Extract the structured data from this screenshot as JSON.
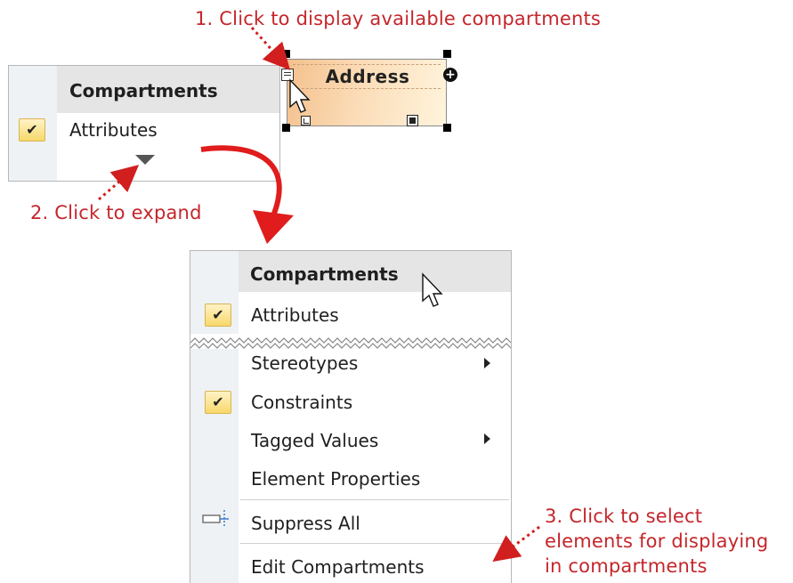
{
  "annotations": {
    "step1": "1. Click to display available compartments",
    "step2": "2. Click to expand",
    "step3_line1": "3. Click to select",
    "step3_line2": "elements for displaying",
    "step3_line3": "in compartments"
  },
  "element": {
    "title": "Address"
  },
  "collapsed_menu": {
    "header": "Compartments",
    "items": [
      {
        "label": "Attributes",
        "checked": true
      }
    ]
  },
  "expanded_menu": {
    "header": "Compartments",
    "items": [
      {
        "label": "Attributes",
        "checked": true
      },
      {
        "label": "Stereotypes",
        "checked": false,
        "submenu": true
      },
      {
        "label": "Constraints",
        "checked": true
      },
      {
        "label": "Tagged Values",
        "checked": false,
        "submenu": true
      },
      {
        "label": "Element Properties",
        "checked": false
      },
      {
        "label": "Suppress All",
        "icon": "suppress-icon"
      },
      {
        "label": "Edit Compartments"
      }
    ]
  },
  "colors": {
    "annotation": "#c4262b",
    "menu_gutter": "#eef2f4",
    "menu_header": "#e5e5e5",
    "check_fill": "#f7d86a"
  }
}
